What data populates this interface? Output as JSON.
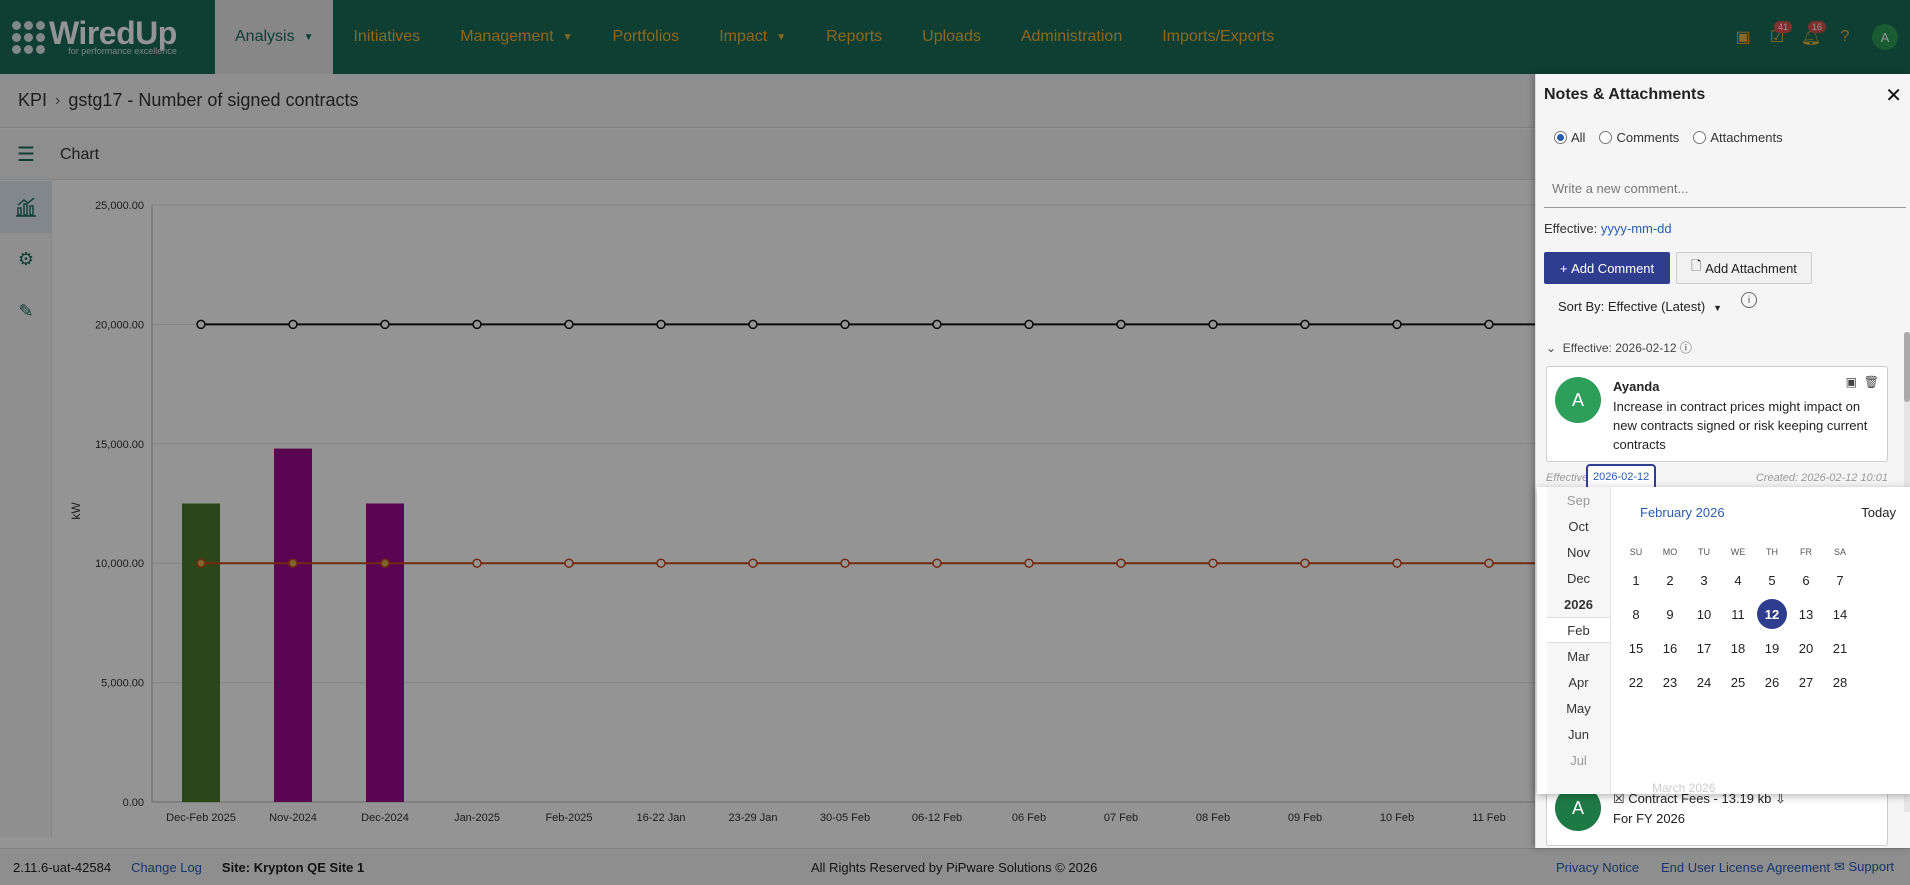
{
  "logo": {
    "name": "WiredUp",
    "tagline": "for performance excellence"
  },
  "nav": {
    "items": [
      {
        "label": "Analysis",
        "caret": true,
        "active": true
      },
      {
        "label": "Initiatives"
      },
      {
        "label": "Management",
        "caret": true
      },
      {
        "label": "Portfolios"
      },
      {
        "label": "Impact",
        "caret": true
      },
      {
        "label": "Reports"
      },
      {
        "label": "Uploads"
      },
      {
        "label": "Administration"
      },
      {
        "label": "Imports/Exports"
      }
    ],
    "icons": [
      {
        "name": "calendar-icon",
        "badge": ""
      },
      {
        "name": "tasks-icon",
        "badge": "41"
      },
      {
        "name": "bell-icon",
        "badge": "16"
      },
      {
        "name": "help-icon",
        "badge": ""
      }
    ],
    "avatar": "A"
  },
  "breadcrumb": {
    "root": "KPI",
    "current": "gstg17 - Number of signed contracts"
  },
  "toolbar": {
    "title": "Chart"
  },
  "chart_data": {
    "type": "bar",
    "ylabel": "kW",
    "ylim": [
      0,
      25000
    ],
    "yticks": [
      "25,000.00",
      "20,000.00",
      "15,000.00",
      "10,000.00",
      "5,000.00",
      "0.00"
    ],
    "categories": [
      "Dec-Feb 2025",
      "Nov-2024",
      "Dec-2024",
      "Jan-2025",
      "Feb-2025",
      "16-22 Jan",
      "23-29 Jan",
      "30-05 Feb",
      "06-12 Feb",
      "06 Feb",
      "07 Feb",
      "08 Feb",
      "09 Feb",
      "10 Feb",
      "11 Feb"
    ],
    "bars": [
      12500,
      14800,
      12500,
      null,
      null,
      null,
      null,
      null,
      null,
      null,
      null,
      null,
      null,
      null,
      null
    ],
    "bar_colors": [
      "#4a7a2c",
      "#9b0a8c",
      "#9b0a8c"
    ],
    "series": [
      {
        "values": [
          20000,
          20000,
          20000,
          20000,
          20000,
          20000,
          20000,
          20000,
          20000,
          20000,
          20000,
          20000,
          20000,
          20000,
          20000
        ],
        "color": "#111111"
      },
      {
        "values": [
          10000,
          10000,
          10000,
          10000,
          10000,
          10000,
          10000,
          10000,
          10000,
          10000,
          10000,
          10000,
          10000,
          10000,
          10000
        ],
        "color": "#c8461d"
      }
    ]
  },
  "footer": {
    "version": "2.11.6-uat-42584",
    "changelog": "Change Log",
    "site": "Site: Krypton QE Site 1",
    "copyright": "All Rights Reserved by PiPware Solutions © 2026",
    "privacy": "Privacy Notice",
    "eula": "End User License Agreement",
    "support": "Support"
  },
  "panel": {
    "title": "Notes & Attachments",
    "filters": [
      "All",
      "Comments",
      "Attachments"
    ],
    "comment_placeholder": "Write a new comment...",
    "effective_label": "Effective:",
    "effective_value": "yyyy-mm-dd",
    "add_comment": "Add Comment",
    "add_attachment": "Add Attachment",
    "sort_label": "Sort By: Effective (Latest)",
    "group_header": "Effective: 2026-02-12",
    "note": {
      "avatar": "A",
      "author": "Ayanda",
      "text": "Increase in contract prices might impact on new contracts signed or risk keeping current contracts",
      "meta_effective": "Effective:",
      "meta_date": "2026-02-12",
      "meta_created": "Created: 2026-02-12 10:01"
    },
    "note2": {
      "avatar": "A",
      "attachment": "Contract Fees - 13.19 kb",
      "text": "For FY 2026"
    }
  },
  "datepicker": {
    "months": [
      "Sep",
      "Oct",
      "Nov",
      "Dec",
      "2026",
      "Feb",
      "Mar",
      "Apr",
      "May",
      "Jun",
      "Jul"
    ],
    "month_title": "February 2026",
    "today": "Today",
    "ghost": "March 2026",
    "dow": [
      "SU",
      "MO",
      "TU",
      "WE",
      "TH",
      "FR",
      "SA"
    ],
    "weeks": [
      [
        "1",
        "2",
        "3",
        "4",
        "5",
        "6",
        "7"
      ],
      [
        "8",
        "9",
        "10",
        "11",
        "12",
        "13",
        "14"
      ],
      [
        "15",
        "16",
        "17",
        "18",
        "19",
        "20",
        "21"
      ],
      [
        "22",
        "23",
        "24",
        "25",
        "26",
        "27",
        "28"
      ]
    ],
    "selected": "12"
  }
}
